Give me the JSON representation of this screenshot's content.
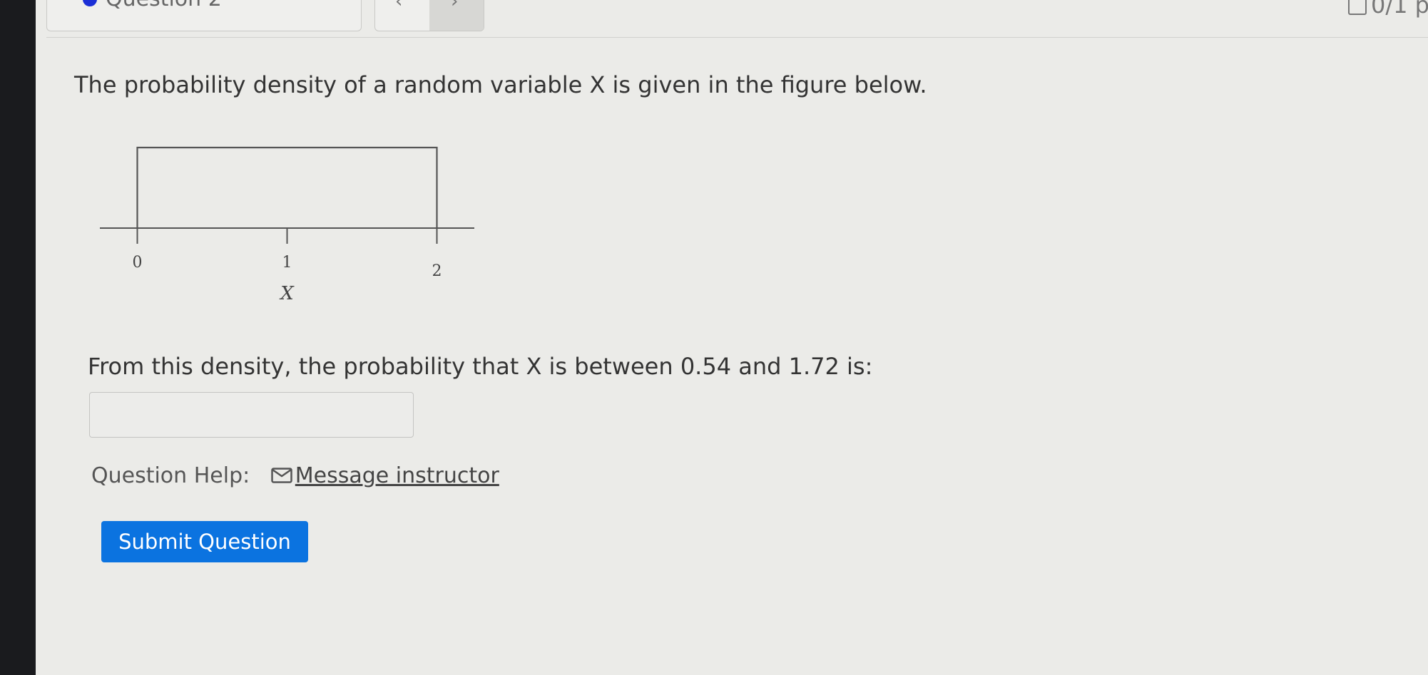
{
  "header": {
    "question_selector": {
      "label": "Question 2"
    },
    "score": "0/1 p"
  },
  "question": {
    "prompt": "The probability density of a random variable X is given in the figure below.",
    "text": "From this density, the probability that X is between 0.54 and 1.72 is:",
    "answer": {
      "value": "",
      "placeholder": ""
    }
  },
  "help": {
    "label": "Question Help:",
    "link_label": "Message instructor"
  },
  "submit_label": "Submit Question",
  "chart_data": {
    "type": "area",
    "x": [
      0,
      2
    ],
    "density_region": {
      "x_start": 0,
      "x_end": 2
    },
    "xticks": [
      "0",
      "1",
      "2"
    ],
    "xlabel": "X",
    "xlim": [
      -0.25,
      2.25
    ]
  }
}
